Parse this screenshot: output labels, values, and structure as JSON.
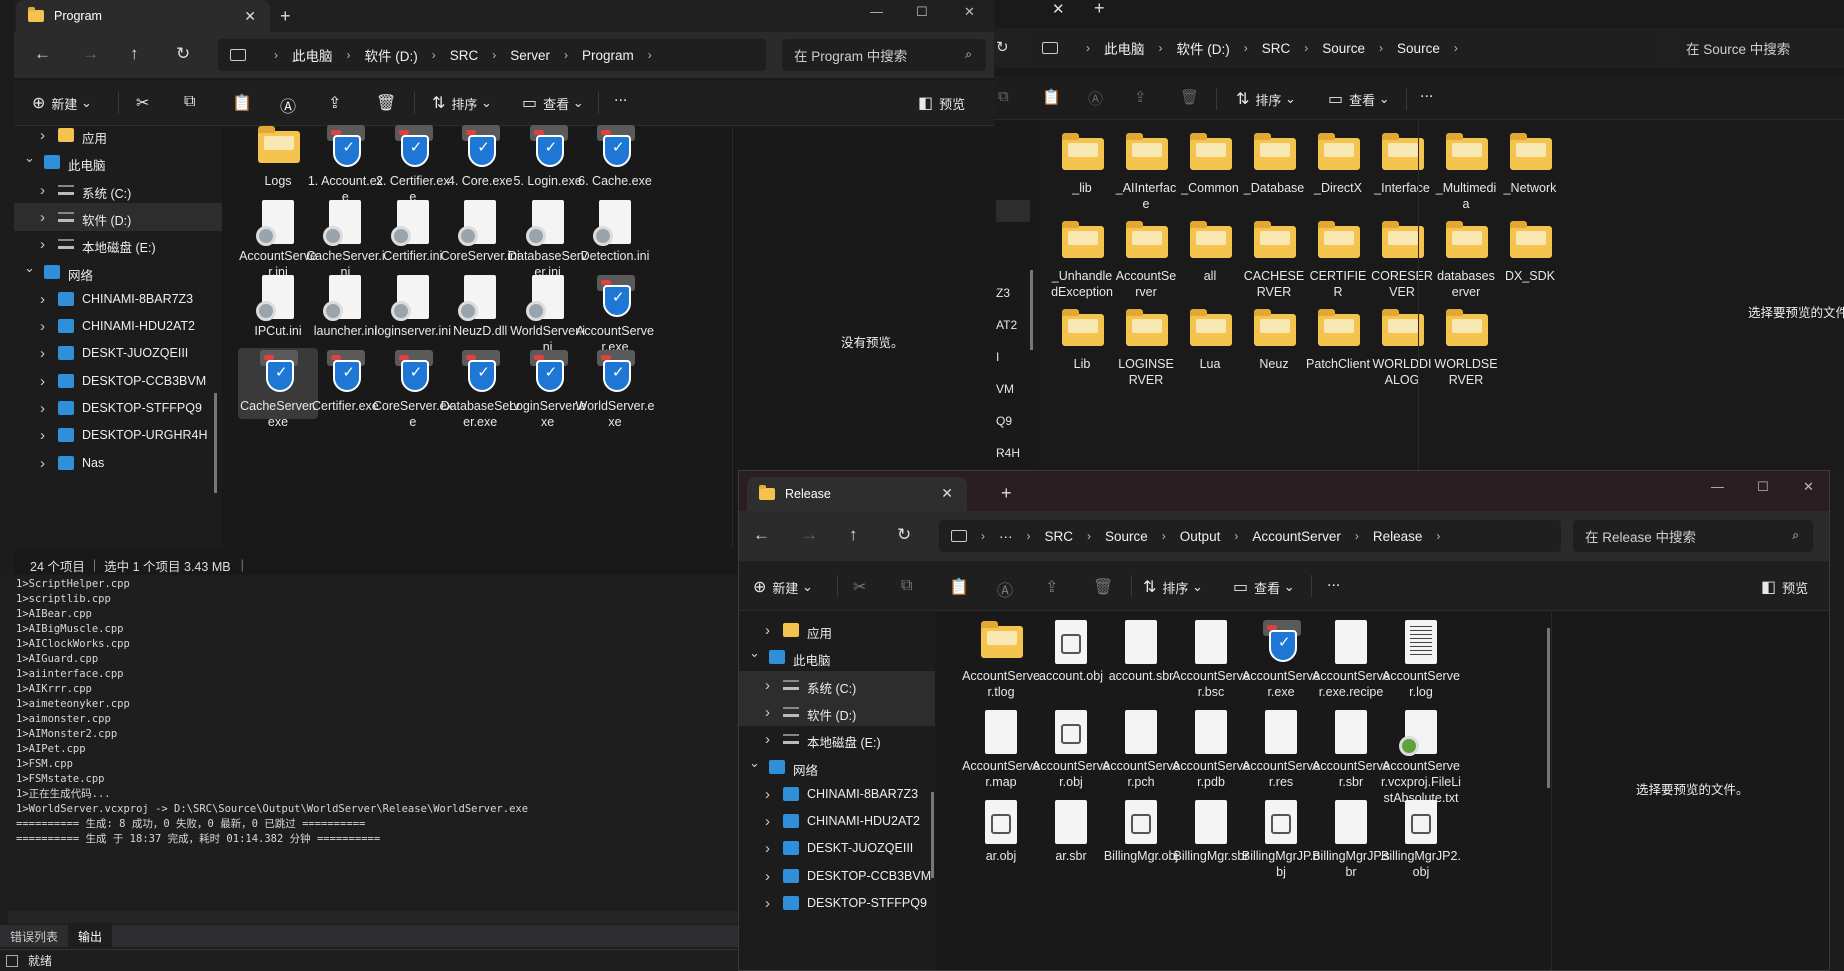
{
  "win_program": {
    "tab_title": "Program",
    "crumbs": [
      "此电脑",
      "软件 (D:)",
      "SRC",
      "Server",
      "Program"
    ],
    "search_placeholder": "在 Program 中搜索",
    "toolbar": {
      "new": "新建",
      "sort": "排序",
      "view": "查看",
      "more": "...",
      "preview": "预览"
    },
    "nav": [
      {
        "label": "应用",
        "indent": 1,
        "expanded": false
      },
      {
        "label": "此电脑",
        "indent": 0,
        "expanded": true
      },
      {
        "label": "系统 (C:)",
        "indent": 1,
        "expanded": false
      },
      {
        "label": "软件 (D:)",
        "indent": 1,
        "expanded": false,
        "selected": true
      },
      {
        "label": "本地磁盘 (E:)",
        "indent": 1,
        "expanded": false
      },
      {
        "label": "网络",
        "indent": 0,
        "expanded": true
      },
      {
        "label": "CHINAMI-8BAR7Z3",
        "indent": 1,
        "expanded": false
      },
      {
        "label": "CHINAMI-HDU2AT2",
        "indent": 1,
        "expanded": false
      },
      {
        "label": "DESKT-JUOZQEIII",
        "indent": 1,
        "expanded": false
      },
      {
        "label": "DESKTOP-CCB3BVM",
        "indent": 1,
        "expanded": false
      },
      {
        "label": "DESKTOP-STFFPQ9",
        "indent": 1,
        "expanded": false
      },
      {
        "label": "DESKTOP-URGHR4H",
        "indent": 1,
        "expanded": false
      },
      {
        "label": "Nas",
        "indent": 1,
        "expanded": false
      }
    ],
    "files": [
      {
        "name": "Logs",
        "icon": "folder"
      },
      {
        "name": "1. Account.exe",
        "icon": "exe"
      },
      {
        "name": "2. Certifier.exe",
        "icon": "exe"
      },
      {
        "name": "4. Core.exe",
        "icon": "exe"
      },
      {
        "name": "5. Login.exe",
        "icon": "exe"
      },
      {
        "name": "6. Cache.exe",
        "icon": "exe"
      },
      {
        "name": "AccountServer.ini",
        "icon": "ini"
      },
      {
        "name": "CacheServer.ini",
        "icon": "ini"
      },
      {
        "name": "Certifier.ini",
        "icon": "ini"
      },
      {
        "name": "CoreServer.ini",
        "icon": "ini"
      },
      {
        "name": "DatabaseServer.ini",
        "icon": "ini"
      },
      {
        "name": "Detection.ini",
        "icon": "ini"
      },
      {
        "name": "IPCut.ini",
        "icon": "ini"
      },
      {
        "name": "launcher.ini",
        "icon": "ini"
      },
      {
        "name": "loginserver.ini",
        "icon": "ini"
      },
      {
        "name": "NeuzD.dll",
        "icon": "dll"
      },
      {
        "name": "WorldServer.ini",
        "icon": "ini"
      },
      {
        "name": "AccountServer.exe",
        "icon": "exe"
      },
      {
        "name": "CacheServer.exe",
        "icon": "exe",
        "selected": true
      },
      {
        "name": "Certifier.exe",
        "icon": "exe"
      },
      {
        "name": "CoreServer.exe",
        "icon": "exe"
      },
      {
        "name": "DatabaseServer.exe",
        "icon": "exe"
      },
      {
        "name": "LoginServer.exe",
        "icon": "exe"
      },
      {
        "name": "WorldServer.exe",
        "icon": "exe"
      }
    ],
    "preview_text": "没有预览。",
    "status": {
      "count": "24 个项目",
      "selection": "选中 1 个项目  3.43 MB"
    }
  },
  "win_source": {
    "crumbs": [
      "此电脑",
      "软件 (D:)",
      "SRC",
      "Source",
      "Source"
    ],
    "search_placeholder": "在 Source 中搜索",
    "toolbar": {
      "sort": "排序",
      "view": "查看",
      "more": "..."
    },
    "files": [
      "_lib",
      "_AIInterface",
      "_Common",
      "_Database",
      "_DirectX",
      "_Interface",
      "_Multimedia",
      "_Network",
      "_UnhandledException",
      "AccountServer",
      "all",
      "CACHESERVER",
      "CERTIFIER",
      "CORESERVER",
      "databaseserver",
      "DX_SDK",
      "Lib",
      "LOGINSERVER",
      "Lua",
      "Neuz",
      "PatchClient",
      "WORLDDIALOG",
      "WORLDSERVER"
    ],
    "preview_text": "选择要预览的文件",
    "side_fragments": [
      "Z3",
      "AT2",
      "I",
      "VM",
      "Q9",
      "R4H"
    ]
  },
  "win_release": {
    "tab_title": "Release",
    "crumbs": [
      "SRC",
      "Source",
      "Output",
      "AccountServer",
      "Release"
    ],
    "search_placeholder": "在 Release 中搜索",
    "toolbar": {
      "new": "新建",
      "sort": "排序",
      "view": "查看",
      "more": "...",
      "preview": "预览"
    },
    "nav": [
      {
        "label": "应用",
        "indent": 1
      },
      {
        "label": "此电脑",
        "indent": 0,
        "expanded": true
      },
      {
        "label": "系统 (C:)",
        "indent": 1,
        "selected": true
      },
      {
        "label": "软件 (D:)",
        "indent": 1,
        "selected": true
      },
      {
        "label": "本地磁盘 (E:)",
        "indent": 1
      },
      {
        "label": "网络",
        "indent": 0,
        "expanded": true
      },
      {
        "label": "CHINAMI-8BAR7Z3",
        "indent": 1
      },
      {
        "label": "CHINAMI-HDU2AT2",
        "indent": 1
      },
      {
        "label": "DESKT-JUOZQEIII",
        "indent": 1
      },
      {
        "label": "DESKTOP-CCB3BVM",
        "indent": 1
      },
      {
        "label": "DESKTOP-STFFPQ9",
        "indent": 1
      }
    ],
    "files": [
      {
        "name": "AccountServer.tlog",
        "icon": "folder"
      },
      {
        "name": "account.obj",
        "icon": "obj"
      },
      {
        "name": "account.sbr",
        "icon": "blank"
      },
      {
        "name": "AccountServer.bsc",
        "icon": "blank"
      },
      {
        "name": "AccountServer.exe",
        "icon": "exe"
      },
      {
        "name": "AccountServer.exe.recipe",
        "icon": "blank"
      },
      {
        "name": "AccountServer.log",
        "icon": "log"
      },
      {
        "name": "AccountServer.map",
        "icon": "blank"
      },
      {
        "name": "AccountServer.obj",
        "icon": "obj"
      },
      {
        "name": "AccountServer.pch",
        "icon": "blank"
      },
      {
        "name": "AccountServer.pdb",
        "icon": "blank"
      },
      {
        "name": "AccountServer.res",
        "icon": "blank"
      },
      {
        "name": "AccountServer.sbr",
        "icon": "blank"
      },
      {
        "name": "AccountServer.vcxproj.FileListAbsolute.txt",
        "icon": "txt"
      },
      {
        "name": "ar.obj",
        "icon": "obj"
      },
      {
        "name": "ar.sbr",
        "icon": "blank"
      },
      {
        "name": "BillingMgr.obj",
        "icon": "obj"
      },
      {
        "name": "BillingMgr.sbr",
        "icon": "blank"
      },
      {
        "name": "BillingMgrJP.obj",
        "icon": "obj"
      },
      {
        "name": "BillingMgrJP.sbr",
        "icon": "blank"
      },
      {
        "name": "BillingMgrJP2.obj",
        "icon": "obj"
      }
    ],
    "preview_text": "选择要预览的文件。"
  },
  "output": {
    "lines": [
      "1>ScriptHelper.cpp",
      "1>scriptlib.cpp",
      "1>AIBear.cpp",
      "1>AIBigMuscle.cpp",
      "1>AIClockWorks.cpp",
      "1>AIGuard.cpp",
      "1>aiinterface.cpp",
      "1>AIKrrr.cpp",
      "1>aimeteonyker.cpp",
      "1>aimonster.cpp",
      "1>AIMonster2.cpp",
      "1>AIPet.cpp",
      "1>FSM.cpp",
      "1>FSMstate.cpp",
      "1>正在生成代码...",
      "1>WorldServer.vcxproj -> D:\\SRC\\Source\\Output\\WorldServer\\Release\\WorldServer.exe",
      "========== 生成: 8 成功，0 失败，0 最新，0 已跳过 ==========",
      "========== 生成 于 18:37 完成，耗时 01:14.382 分钟 =========="
    ],
    "tabs": [
      "错误列表",
      "输出"
    ],
    "status": "就绪"
  }
}
